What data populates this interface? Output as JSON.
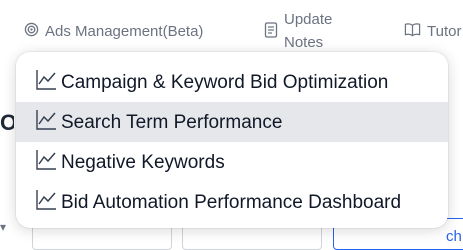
{
  "topnav": {
    "ads_management": {
      "label": "Ads Management(Beta)",
      "icon": "target-icon"
    },
    "update_notes": {
      "line1": "Update",
      "line2": "Notes",
      "icon": "notes-icon"
    },
    "tutorial": {
      "label": "Tutor",
      "icon": "book-icon"
    }
  },
  "background": {
    "heading_fragment": "OI",
    "filter_text": "ch"
  },
  "menu": {
    "items": [
      {
        "label": "Campaign & Keyword Bid Optimization",
        "icon": "trend-chart-icon"
      },
      {
        "label": "Search Term Performance",
        "icon": "trend-chart-icon",
        "highlighted": true
      },
      {
        "label": "Negative Keywords",
        "icon": "trend-chart-icon"
      },
      {
        "label": "Bid Automation Performance Dashboard",
        "icon": "trend-chart-icon"
      }
    ]
  },
  "colors": {
    "nav_text": "#6b7280",
    "hover_bg": "#e5e7eb",
    "accent": "#2563eb"
  }
}
